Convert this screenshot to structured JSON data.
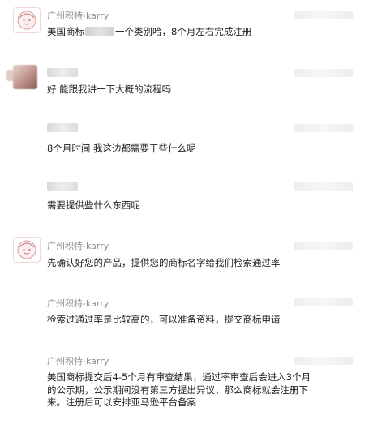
{
  "messages": [
    {
      "sender": "广州积特-karry",
      "text_before": "美国商标",
      "text_after": "一个类别哈，8个月左右完成注册"
    },
    {
      "sender": "",
      "text": "好 能跟我讲一下大概的流程吗"
    },
    {
      "sender": "",
      "text": "8个月时间 我这边都需要干些什么呢"
    },
    {
      "sender": "",
      "text": "需要提供些什么东西呢"
    },
    {
      "sender": "广州积特-karry",
      "text": "先确认好您的产品，提供您的商标名字给我们检索通过率"
    },
    {
      "sender": "广州积特-karry",
      "text": "检索过通过率是比较高的，可以准备资料，提交商标申请"
    },
    {
      "sender": "广州积特-karry",
      "lines": [
        "美国商标提交后4-5个月有审查结果，通过率审查后会进入3个月",
        "的公示期，公示期间没有第三方提出异议，那么商标就会注册下",
        "来。注册后可以安排亚马逊平台备案"
      ]
    }
  ]
}
